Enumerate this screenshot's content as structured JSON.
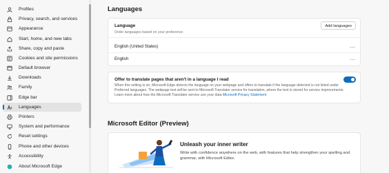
{
  "sidebar": {
    "items": [
      {
        "label": "Profiles",
        "icon": "profile-icon"
      },
      {
        "label": "Privacy, search, and services",
        "icon": "lock-icon"
      },
      {
        "label": "Appearance",
        "icon": "appearance-icon"
      },
      {
        "label": "Start, home, and new tabs",
        "icon": "home-icon"
      },
      {
        "label": "Share, copy and paste",
        "icon": "share-icon"
      },
      {
        "label": "Cookies and site permissions",
        "icon": "cookies-icon"
      },
      {
        "label": "Default browser",
        "icon": "browser-icon"
      },
      {
        "label": "Downloads",
        "icon": "download-icon"
      },
      {
        "label": "Family",
        "icon": "family-icon"
      },
      {
        "label": "Edge bar",
        "icon": "edge-bar-icon"
      },
      {
        "label": "Languages",
        "icon": "languages-icon",
        "active": true
      },
      {
        "label": "Printers",
        "icon": "printer-icon"
      },
      {
        "label": "System and performance",
        "icon": "system-icon"
      },
      {
        "label": "Reset settings",
        "icon": "reset-icon"
      },
      {
        "label": "Phone and other devices",
        "icon": "phone-icon"
      },
      {
        "label": "Accessibility",
        "icon": "accessibility-icon"
      },
      {
        "label": "About Microsoft Edge",
        "icon": "edge-logo-icon"
      }
    ]
  },
  "main": {
    "languages_heading": "Languages",
    "language_card": {
      "title": "Language",
      "subtitle": "Order languages based on your preference",
      "add_button": "Add languages",
      "languages": [
        "English (United States)",
        "English"
      ],
      "more_glyph": "···"
    },
    "translate_card": {
      "title": "Offer to translate pages that aren't in a language I read",
      "description": "When this setting is on, Microsoft Edge detects the language on your webpage and offers to translate if the language detected is not listed under Preferred languages. The webpage text will be sent to Microsoft Translator service for translation, where the text is stored for service improvements. Learn more about how the Microsoft Translator service use your data",
      "link": "Microsoft Privacy Statement",
      "toggle_on": true
    },
    "editor_heading": "Microsoft Editor (Preview)",
    "editor_card": {
      "title": "Unleash your inner writer",
      "description": "Write with confidence anywhere on the web, with features that help strengthen your spelling and grammar, with Microsoft Editor."
    }
  },
  "colors": {
    "accent": "#0f6cbd",
    "page_bg": "#f7f7f7",
    "card_bg": "#ffffff"
  }
}
